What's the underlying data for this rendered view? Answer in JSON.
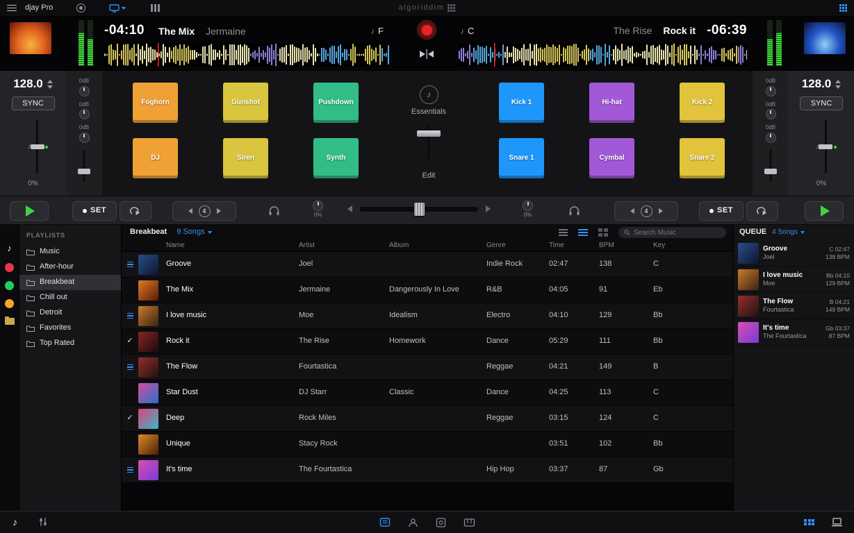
{
  "topbar": {
    "app_name": "djay Pro",
    "brand": "algoriddim"
  },
  "glyphs": {
    "note": "♪",
    "check": "✓"
  },
  "decks": {
    "left": {
      "time_remaining": "-04:10",
      "title": "The Mix",
      "artist": "Jermaine",
      "key": "F",
      "art": [
        "#f7b23c",
        "#e0611e",
        "#641404"
      ]
    },
    "right": {
      "time_remaining": "-06:39",
      "title": "Rock it",
      "artist": "The Rise",
      "key": "C",
      "art": [
        "#8fd0f5",
        "#2356c8",
        "#0a1030"
      ]
    }
  },
  "deck_controls": {
    "left": {
      "bpm": "128.0",
      "sync_label": "SYNC",
      "pitch_percent": "0%",
      "gain_labels": [
        "0dB",
        "0dB",
        "0dB"
      ]
    },
    "right": {
      "bpm": "128.0",
      "sync_label": "SYNC",
      "pitch_percent": "0%",
      "gain_labels": [
        "0dB",
        "0dB",
        "0dB"
      ]
    }
  },
  "pads": {
    "left": [
      {
        "label": "Foghorn",
        "color": "#f0a136"
      },
      {
        "label": "Gunshot",
        "color": "#d9c63e"
      },
      {
        "label": "Pushdown",
        "color": "#32bd87"
      },
      {
        "label": "DJ",
        "color": "#f0a136"
      },
      {
        "label": "Siren",
        "color": "#d9c63e"
      },
      {
        "label": "Synth",
        "color": "#32bd87"
      }
    ],
    "right": [
      {
        "label": "Kick 1",
        "color": "#1e97fd"
      },
      {
        "label": "Hi-hat",
        "color": "#a159d8"
      },
      {
        "label": "Kick 2",
        "color": "#e2c33c"
      },
      {
        "label": "Snare 1",
        "color": "#1e97fd"
      },
      {
        "label": "Cymbal",
        "color": "#a159d8"
      },
      {
        "label": "Snare 2",
        "color": "#e2c33c"
      }
    ]
  },
  "fx": {
    "name": "Essentials",
    "edit_label": "Edit"
  },
  "transport": {
    "set_label": "SET",
    "loop_beats": "4",
    "cue_left_percent": "0%",
    "cue_right_percent": "0%"
  },
  "library": {
    "sidebar": {
      "title": "PLAYLISTS",
      "items": [
        "Music",
        "After-hour",
        "Breakbeat",
        "Chill out",
        "Detroit",
        "Favorites",
        "Top Rated"
      ],
      "selected_index": 2
    },
    "header": {
      "title": "Breakbeat",
      "count_label": "9 Songs"
    },
    "search": {
      "placeholder": "Search Music"
    },
    "columns": [
      "Name",
      "Artist",
      "Album",
      "Genre",
      "Time",
      "BPM",
      "Key"
    ],
    "songs": [
      {
        "name": "Groove",
        "artist": "Joel",
        "album": "",
        "genre": "Indie Rock",
        "time": "02:47",
        "bpm": "138",
        "key": "C",
        "marker": "queue",
        "art": [
          "#2a4f8a",
          "#0a1530"
        ]
      },
      {
        "name": "The Mix",
        "artist": "Jermaine",
        "album": "Dangerously In Love",
        "genre": "R&B",
        "time": "04:05",
        "bpm": "91",
        "key": "Eb",
        "marker": "",
        "art": [
          "#e07a22",
          "#5a1c08"
        ]
      },
      {
        "name": "I love music",
        "artist": "Moe",
        "album": "Idealism",
        "genre": "Electro",
        "time": "04:10",
        "bpm": "129",
        "key": "Bb",
        "marker": "queue",
        "art": [
          "#c87c2a",
          "#3a2410"
        ]
      },
      {
        "name": "Rock it",
        "artist": "The Rise",
        "album": "Homework",
        "genre": "Dance",
        "time": "05:29",
        "bpm": "111",
        "key": "Bb",
        "marker": "check",
        "art": [
          "#8a2424",
          "#1c0a0a"
        ]
      },
      {
        "name": "The Flow",
        "artist": "Fourtastica",
        "album": "",
        "genre": "Reggae",
        "time": "04:21",
        "bpm": "149",
        "key": "B",
        "marker": "queue",
        "art": [
          "#93302c",
          "#241010"
        ]
      },
      {
        "name": "Star Dust",
        "artist": "DJ Starr",
        "album": "Classic",
        "genre": "Dance",
        "time": "04:25",
        "bpm": "113",
        "key": "C",
        "marker": "",
        "art": [
          "#d04f9e",
          "#2a6fc9"
        ]
      },
      {
        "name": "Deep",
        "artist": "Rock Miles",
        "album": "",
        "genre": "Reggae",
        "time": "03:15",
        "bpm": "124",
        "key": "C",
        "marker": "check",
        "art": [
          "#e0437a",
          "#3bb5c9"
        ]
      },
      {
        "name": "Unique",
        "artist": "Stacy Rock",
        "album": "",
        "genre": "",
        "time": "03:51",
        "bpm": "102",
        "key": "Bb",
        "marker": "",
        "art": [
          "#e08a28",
          "#4a2008"
        ]
      },
      {
        "name": "It's time",
        "artist": "The Fourtastica",
        "album": "",
        "genre": "Hip Hop",
        "time": "03:37",
        "bpm": "87",
        "key": "Gb",
        "marker": "queue",
        "art": [
          "#d84fb0",
          "#7a3ad8"
        ]
      }
    ]
  },
  "queue": {
    "title": "QUEUE",
    "count_label": "4 Songs",
    "items": [
      {
        "title": "Groove",
        "artist": "Joel",
        "key_time": "C 02:47",
        "bpm": "138 BPM",
        "art": [
          "#2a4f8a",
          "#0a1530"
        ]
      },
      {
        "title": "I love music",
        "artist": "Moe",
        "key_time": "Bb 04:10",
        "bpm": "129 BPM",
        "art": [
          "#c87c2a",
          "#3a2410"
        ]
      },
      {
        "title": "The Flow",
        "artist": "Fourtastica",
        "key_time": "B 04:21",
        "bpm": "149 BPM",
        "art": [
          "#93302c",
          "#241010"
        ]
      },
      {
        "title": "It's time",
        "artist": "The Fourtastica",
        "key_time": "Gb 03:37",
        "bpm": "87 BPM",
        "art": [
          "#d84fb0",
          "#7a3ad8"
        ]
      }
    ]
  },
  "colors": {
    "accent_blue": "#3b8df0",
    "play_green": "#3fd348",
    "record_red": "#ea2424"
  }
}
